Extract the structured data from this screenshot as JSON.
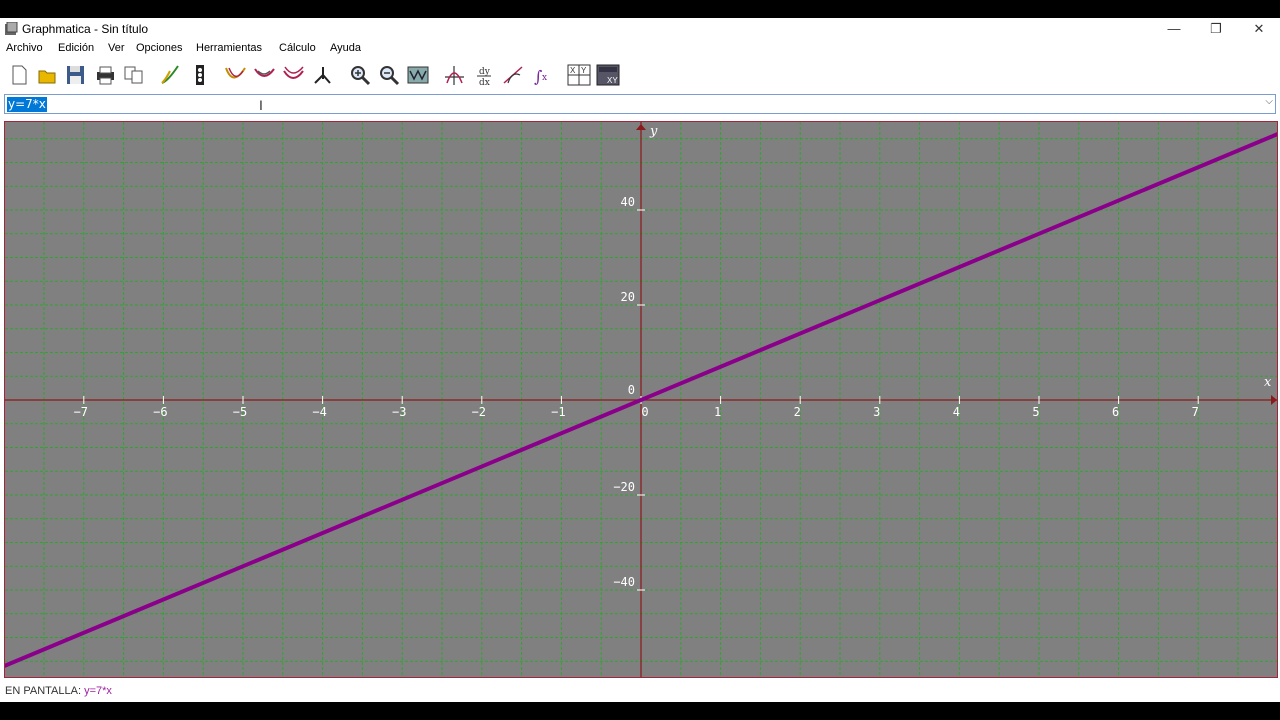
{
  "window": {
    "title": "Graphmatica - Sin título",
    "controls": {
      "minimize": "—",
      "maximize": "❐",
      "close": "✕"
    }
  },
  "menu": {
    "items": [
      "Archivo",
      "Edición",
      "Ver",
      "Opciones",
      "Herramientas",
      "Cálculo",
      "Ayuda"
    ]
  },
  "toolbar": {
    "buttons": [
      "new-icon",
      "open-icon",
      "save-icon",
      "print-icon",
      "copy-icon",
      "graph-icon",
      "delete-icon",
      "curve-icon",
      "curve-icon-2",
      "curve-icon-3",
      "point-icon",
      "zoom-in-icon",
      "zoom-out-icon",
      "zoom-fit-icon",
      "tangent-icon",
      "derivative-icon",
      "slope-icon",
      "integral-icon",
      "table-icon",
      "grid-table-icon"
    ]
  },
  "equation_input": {
    "value": "y=7*x"
  },
  "graph": {
    "background": "#808080",
    "grid_color": "#2fa52f",
    "axis_color": "#8b1a1a",
    "curve_color": "#8b008b",
    "x_label": "x",
    "y_label": "y",
    "x_ticks": [
      "−7",
      "−6",
      "−5",
      "−4",
      "−3",
      "−2",
      "−1",
      "0",
      "1",
      "2",
      "3",
      "4",
      "5",
      "6",
      "7"
    ],
    "y_ticks": [
      "40",
      "20",
      "0",
      "−20",
      "−40"
    ]
  },
  "chart_data": {
    "type": "line",
    "title": "",
    "xlabel": "x",
    "ylabel": "y",
    "xlim": [
      -8,
      8
    ],
    "ylim": [
      -58,
      58
    ],
    "grid": true,
    "series": [
      {
        "name": "y=7*x",
        "x": [
          -8,
          8
        ],
        "y": [
          -56,
          56
        ]
      }
    ]
  },
  "status": {
    "label": "EN PANTALLA:",
    "equation": "y=7*x"
  }
}
